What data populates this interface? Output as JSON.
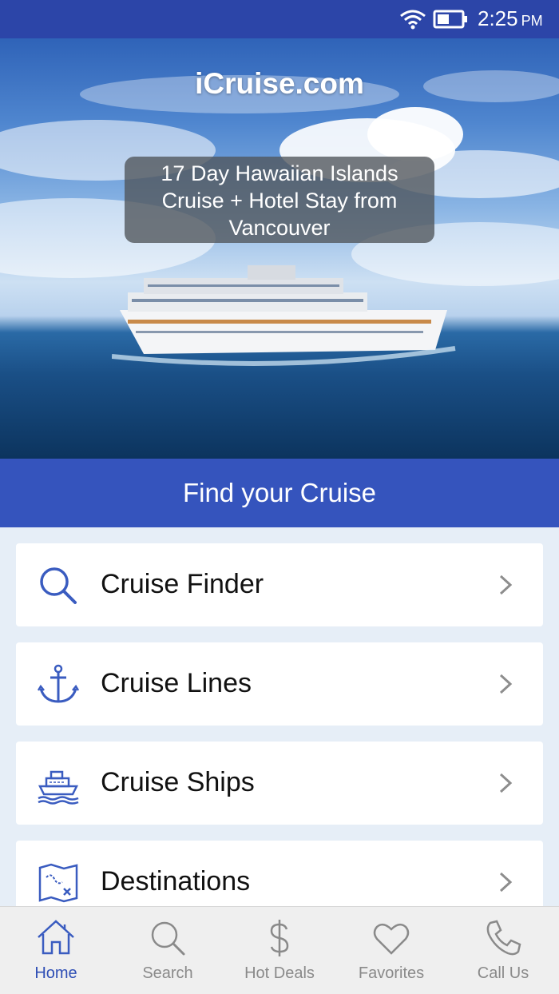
{
  "status_bar": {
    "time": "2:25",
    "ampm": "PM",
    "wifi_icon": "wifi-icon",
    "battery_icon": "battery-icon"
  },
  "hero": {
    "title": "iCruise.com",
    "promo_line1": "17 Day Hawaiian Islands",
    "promo_line2": "Cruise + Hotel Stay from",
    "promo_line3": "Vancouver"
  },
  "find_header": "Find your Cruise",
  "menu": [
    {
      "label": "Cruise Finder",
      "icon": "search-icon"
    },
    {
      "label": "Cruise Lines",
      "icon": "anchor-icon"
    },
    {
      "label": "Cruise Ships",
      "icon": "ship-icon"
    },
    {
      "label": "Destinations",
      "icon": "map-icon"
    }
  ],
  "tabs": [
    {
      "label": "Home",
      "icon": "home-icon",
      "active": true
    },
    {
      "label": "Search",
      "icon": "search-icon",
      "active": false
    },
    {
      "label": "Hot Deals",
      "icon": "dollar-icon",
      "active": false
    },
    {
      "label": "Favorites",
      "icon": "heart-icon",
      "active": false
    },
    {
      "label": "Call Us",
      "icon": "phone-icon",
      "active": false
    }
  ],
  "colors": {
    "primary": "#3554bd",
    "status_bar": "#2c45a8",
    "icon_blue": "#3a5cc0",
    "tab_inactive": "#8a8a8a",
    "background": "#e6eef7"
  }
}
